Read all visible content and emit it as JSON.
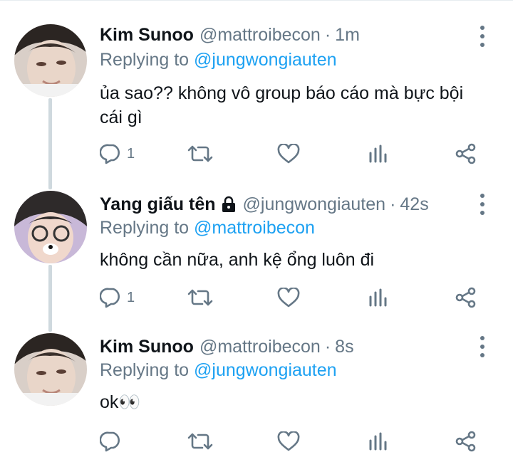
{
  "tweets": [
    {
      "name": "Kim Sunoo",
      "handle": "@mattroibecon",
      "separator": "·",
      "time": "1m",
      "replying_prefix": "Replying to",
      "replying_to": "@jungwongiauten",
      "text": "ủa sao?? không vô group báo cáo mà bực bội cái gì",
      "reply_count": "1"
    },
    {
      "name": "Yang giấu tên",
      "handle": "@jungwongiauten",
      "separator": "·",
      "time": "42s",
      "replying_prefix": "Replying to",
      "replying_to": "@mattroibecon",
      "text": "không cần nữa, anh kệ ổng luôn đi",
      "reply_count": "1"
    },
    {
      "name": "Kim Sunoo",
      "handle": "@mattroibecon",
      "separator": "·",
      "time": "8s",
      "replying_prefix": "Replying to",
      "replying_to": "@jungwongiauten",
      "text": "ok👀",
      "reply_count": ""
    }
  ],
  "icons": {
    "reply": "reply-icon",
    "retweet": "retweet-icon",
    "like": "heart-icon",
    "analytics": "analytics-icon",
    "share": "share-icon",
    "more": "more-vertical-icon",
    "lock": "lock-icon"
  },
  "colors": {
    "text": "#0f1419",
    "secondary": "#657786",
    "mention": "#1da1f2",
    "thread_line": "#cfd9de"
  }
}
